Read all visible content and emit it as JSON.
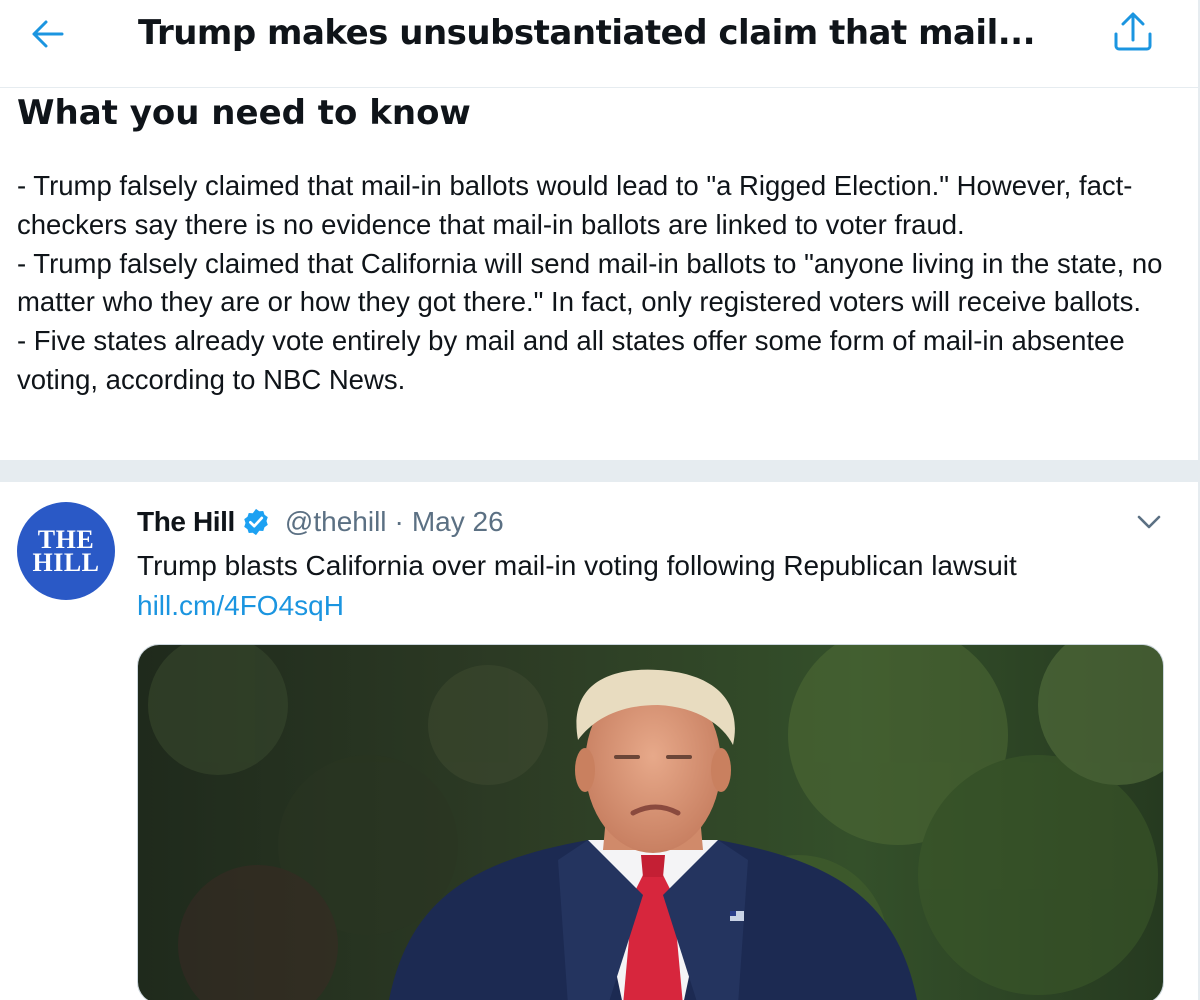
{
  "header": {
    "title": "Trump makes unsubstantiated claim that mail...",
    "back_icon": "arrow-left-icon",
    "share_icon": "share-icon"
  },
  "summary": {
    "heading": "What you need to know",
    "paragraphs": [
      "- Trump falsely claimed that mail-in ballots would lead to \"a Rigged Election.\" However, fact-checkers say there is no evidence that mail-in ballots are linked to voter fraud.",
      "- Trump falsely claimed that California will send mail-in ballots to \"anyone living in the state, no matter who they are or how they got there.\" In fact, only registered voters will receive ballots.",
      "- Five states already vote entirely by mail and all states offer some form of mail-in absentee voting, according to NBC News."
    ]
  },
  "tweet": {
    "avatar_line1": "THE",
    "avatar_line2": "HILL",
    "author": "The Hill",
    "handle": "@thehill",
    "separator": "·",
    "date": "May 26",
    "text": "Trump blasts California over mail-in voting following Republican lawsuit",
    "link": "hill.cm/4FO4sqH",
    "verified_icon": "verified-badge-icon",
    "menu_icon": "chevron-down-icon",
    "media_subject": "photo-of-man-in-suit"
  },
  "colors": {
    "accent": "#1b95e0",
    "text": "#0f1419",
    "secondary": "#5b7083",
    "divider": "#e6ecf0",
    "avatar_bg": "#2a59c6"
  }
}
